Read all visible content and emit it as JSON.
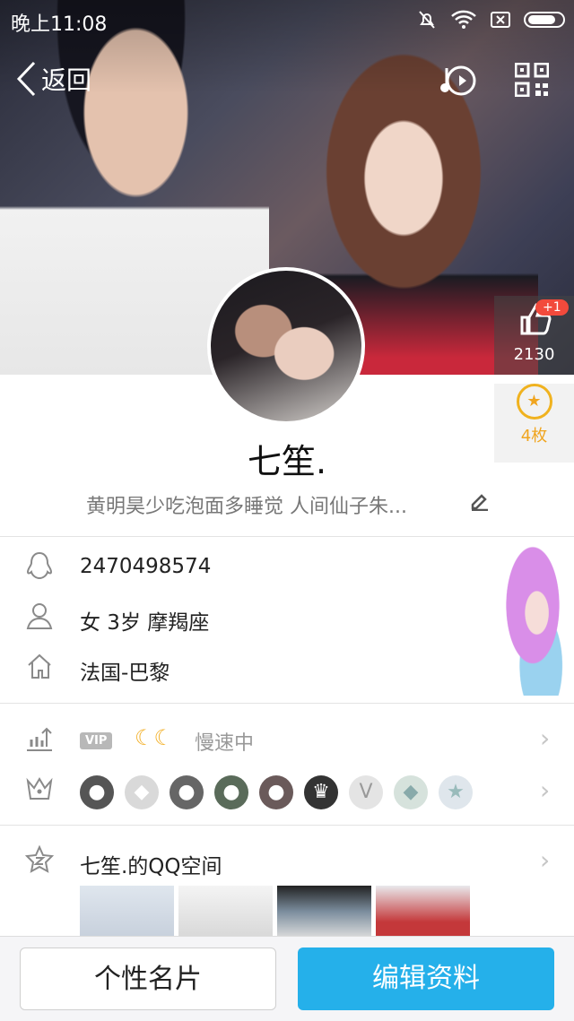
{
  "status_bar": {
    "time": "晚上11:08"
  },
  "nav": {
    "back_label": "返回"
  },
  "profile": {
    "name": "七笙.",
    "signature": "黄明昊少吃泡面多睡觉 人间仙子朱...",
    "likes_count": "2130",
    "likes_delta": "+1",
    "gift_count": "4枚"
  },
  "info": {
    "qq_number": "2470498574",
    "basic": "女  3岁  摩羯座",
    "location": "法国-巴黎"
  },
  "vip": {
    "tag": "VIP",
    "speed_text": "慢速中"
  },
  "qzone": {
    "title": "七笙.的QQ空间"
  },
  "actions": {
    "card_label": "个性名片",
    "edit_label": "编辑资料"
  },
  "colors": {
    "primary": "#25b0ea",
    "badge_red": "#f24a3c",
    "gold": "#f0b21f"
  }
}
